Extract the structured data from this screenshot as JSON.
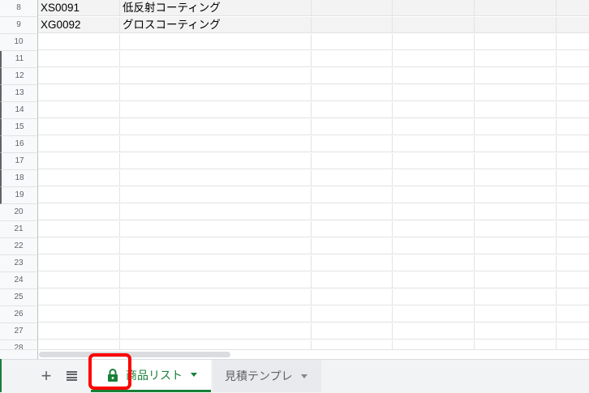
{
  "rows": [
    {
      "num": "8",
      "cells": [
        "XS0091",
        "低反射コーティング"
      ]
    },
    {
      "num": "9",
      "cells": [
        "XG0092",
        "グロスコーティング"
      ]
    },
    {
      "num": "10",
      "cells": [
        "",
        ""
      ]
    },
    {
      "num": "11",
      "cells": [
        "",
        ""
      ]
    },
    {
      "num": "12",
      "cells": [
        "",
        ""
      ]
    },
    {
      "num": "13",
      "cells": [
        "",
        ""
      ]
    },
    {
      "num": "14",
      "cells": [
        "",
        ""
      ]
    },
    {
      "num": "15",
      "cells": [
        "",
        ""
      ]
    },
    {
      "num": "16",
      "cells": [
        "",
        ""
      ]
    },
    {
      "num": "17",
      "cells": [
        "",
        ""
      ]
    },
    {
      "num": "18",
      "cells": [
        "",
        ""
      ]
    },
    {
      "num": "19",
      "cells": [
        "",
        ""
      ]
    },
    {
      "num": "20",
      "cells": [
        "",
        ""
      ]
    },
    {
      "num": "21",
      "cells": [
        "",
        ""
      ]
    },
    {
      "num": "22",
      "cells": [
        "",
        ""
      ]
    },
    {
      "num": "23",
      "cells": [
        "",
        ""
      ]
    },
    {
      "num": "24",
      "cells": [
        "",
        ""
      ]
    },
    {
      "num": "25",
      "cells": [
        "",
        ""
      ]
    },
    {
      "num": "26",
      "cells": [
        "",
        ""
      ]
    },
    {
      "num": "27",
      "cells": [
        "",
        ""
      ]
    },
    {
      "num": "28",
      "cells": [
        "",
        ""
      ]
    }
  ],
  "tabbar": {
    "add_label": "+",
    "tabs": [
      {
        "label": "商品リスト",
        "active": true,
        "locked": true
      },
      {
        "label": "見積テンプレ",
        "active": false,
        "locked": false
      }
    ]
  },
  "colors": {
    "accent": "#188038",
    "annotation": "#ff0000"
  },
  "icons": [
    "plus-icon",
    "list-icon",
    "lock-icon",
    "caret-down-icon"
  ]
}
